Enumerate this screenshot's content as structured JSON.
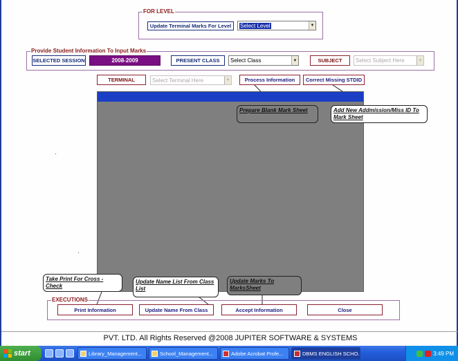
{
  "level": {
    "frame_title": "FOR LEVEL",
    "button": "Update Terminal Marks For Level",
    "select": "Select Level"
  },
  "student_info": {
    "frame_title": "Provide Student Information To Input Marks",
    "selected_session_label": "SELECTED SESSION",
    "session_value": "2008-2009",
    "present_class_label": "PRESENT CLASS",
    "class_select": "Select Class",
    "subject_label": "SUBJECT",
    "subject_select": "Select Subject Here"
  },
  "terminal": {
    "label": "TERMINAL",
    "select": "Select Terminal Here",
    "process_button": "Process Information",
    "correct_button": "Correct Missing STDID"
  },
  "callouts": {
    "prepare": "Prepare Blank Mark Sheet",
    "add_new": "Add New Addmission/Miss ID To Mark Sheet",
    "take_print": "Take Print For Cross - Check",
    "update_name_list": "Update Name List From Class List",
    "update_marks": "Update Marks To MarksSheet"
  },
  "executions": {
    "frame_title": "EXECUTIONS",
    "print": "Print Information",
    "update_name": "Update Name From Class",
    "accept": "Accept Information",
    "close": "Close"
  },
  "footer": "PVT. LTD. All Rights Reserved @2008 JUPITER SOFTWARE & SYSTEMS",
  "taskbar": {
    "start": "start",
    "tasks": [
      "Library_Management...",
      "School_Management...",
      "Adobe Acrobat Profe...",
      "DBMS ENGLISH SCHO..."
    ],
    "clock": "3:49 PM"
  },
  "colors": {
    "grid_background": "#7f7f7f",
    "grid_header": "#1a3fc5",
    "session_value_bg": "#7a0f83",
    "frame_border": "#9d6fa6"
  }
}
